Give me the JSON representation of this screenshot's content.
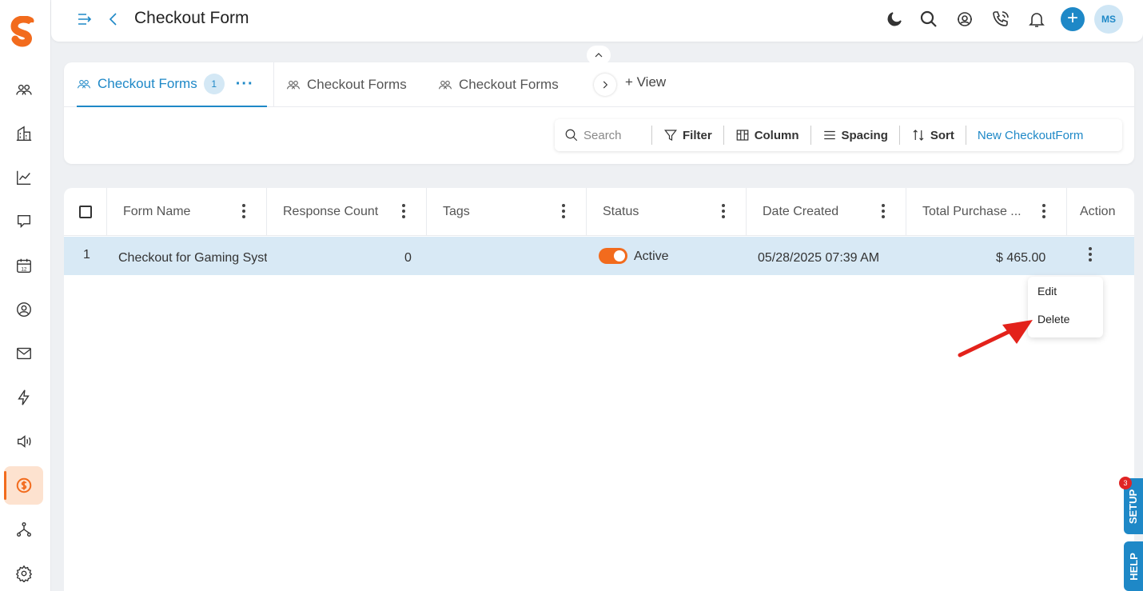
{
  "header": {
    "title": "Checkout Form",
    "avatar_initials": "MS",
    "plus_label": "+"
  },
  "tabs": [
    {
      "label": "Checkout Forms",
      "count": "1",
      "active": true
    },
    {
      "label": "Checkout Forms",
      "active": false
    },
    {
      "label": "Checkout Forms",
      "active": false
    }
  ],
  "add_view_label": "+ View",
  "toolbar": {
    "search_placeholder": "Search",
    "filter": "Filter",
    "column": "Column",
    "spacing": "Spacing",
    "sort": "Sort",
    "new": "New CheckoutForm"
  },
  "table": {
    "columns": [
      "Form Name",
      "Response Count",
      "Tags",
      "Status",
      "Date Created",
      "Total Purchase ...",
      "Action"
    ],
    "rows": [
      {
        "index": "1",
        "form_name": "Checkout for Gaming Syst",
        "response_count": "0",
        "tags": "",
        "status": "Active",
        "date_created": "05/28/2025 07:39 AM",
        "total_purchase": "$ 465.00"
      }
    ]
  },
  "row_menu": {
    "edit": "Edit",
    "delete": "Delete"
  },
  "side_tabs": {
    "setup": "SETUP",
    "setup_badge": "3",
    "help": "HELP"
  },
  "colors": {
    "accent": "#1e88c7",
    "brand": "#f26b1d",
    "row_highlight": "#d8e9f5"
  }
}
